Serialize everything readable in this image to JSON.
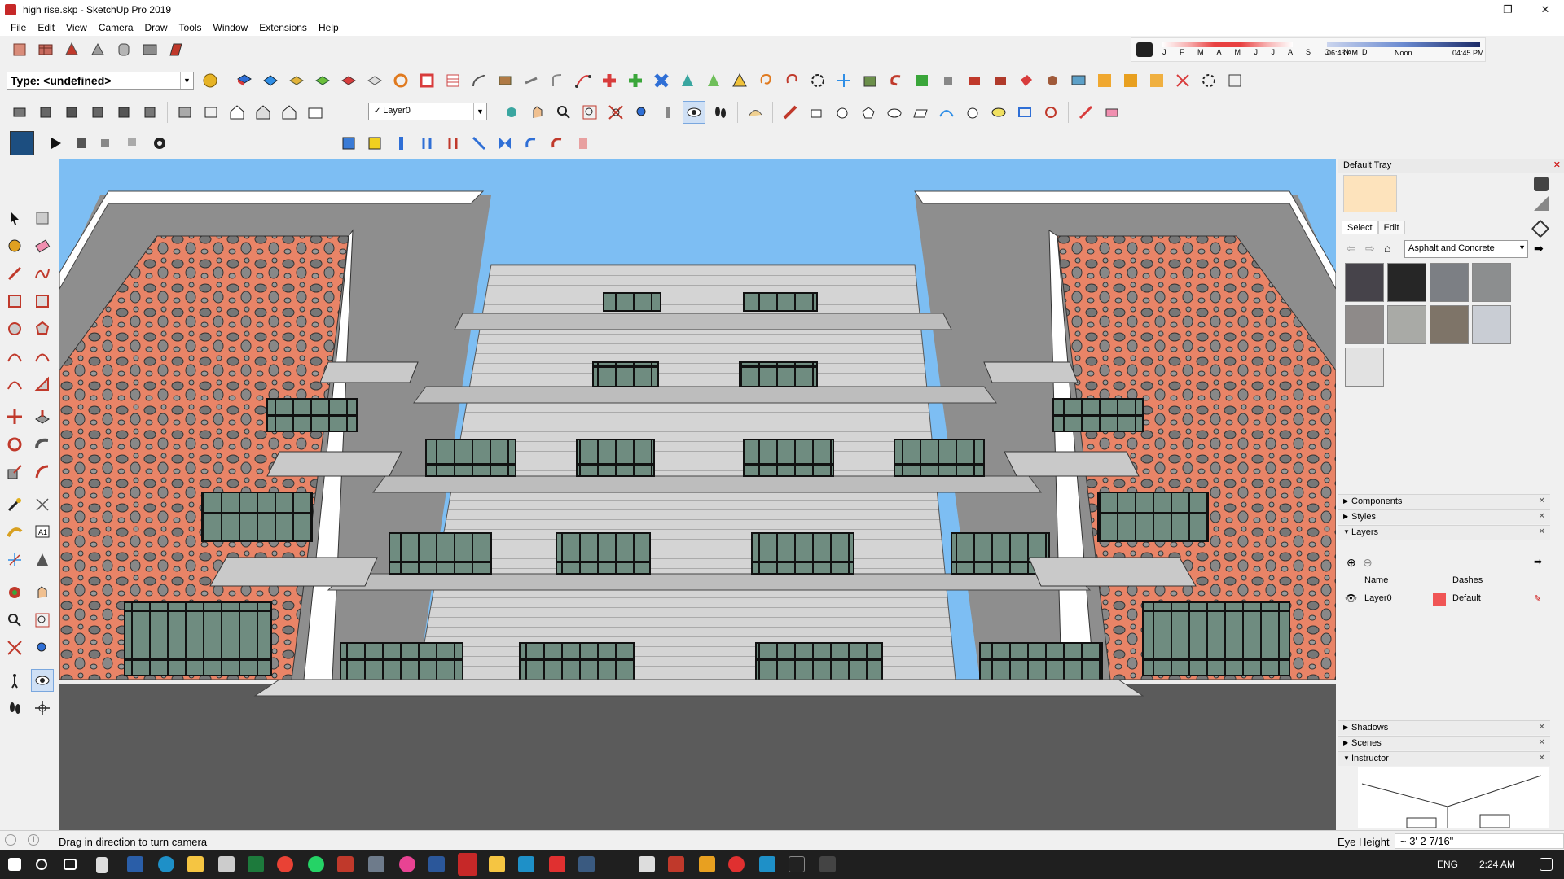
{
  "window": {
    "title": "high rise.skp - SketchUp Pro 2019",
    "minimize": "—",
    "maximize": "❐",
    "close": "✕"
  },
  "menu": [
    "File",
    "Edit",
    "View",
    "Camera",
    "Draw",
    "Tools",
    "Window",
    "Extensions",
    "Help"
  ],
  "type_selector": {
    "value": "Type: <undefined>"
  },
  "layer_selector": {
    "value": "Layer0"
  },
  "shadow_bar": {
    "months": "J F M A M J J A S O N D",
    "time_start": "06:43 AM",
    "time_mid": "Noon",
    "time_end": "04:45 PM"
  },
  "tray": {
    "title": "Default Tray",
    "tabs": [
      "Select",
      "Edit"
    ],
    "material_collection": "Asphalt and Concrete",
    "material_colors": [
      "#46434a",
      "#262626",
      "#7c7f84",
      "#8c8e8f",
      "#8e8a89",
      "#a9aaa6",
      "#7e7468",
      "#c9cdd4",
      "#e2e2e2"
    ],
    "panels": {
      "components": "Components",
      "styles": "Styles",
      "layers": "Layers",
      "shadows": "Shadows",
      "scenes": "Scenes",
      "instructor": "Instructor"
    },
    "layers_table": {
      "col_name": "Name",
      "col_dashes": "Dashes",
      "row_name": "Layer0",
      "row_color": "#f05555",
      "row_dashes": "Default"
    }
  },
  "status": {
    "message": "Drag in direction to turn camera",
    "measure_label": "Eye Height",
    "measure_value": "~ 3' 2 7/16\""
  },
  "taskbar": {
    "lang": "ENG",
    "time": "2:24 AM"
  }
}
